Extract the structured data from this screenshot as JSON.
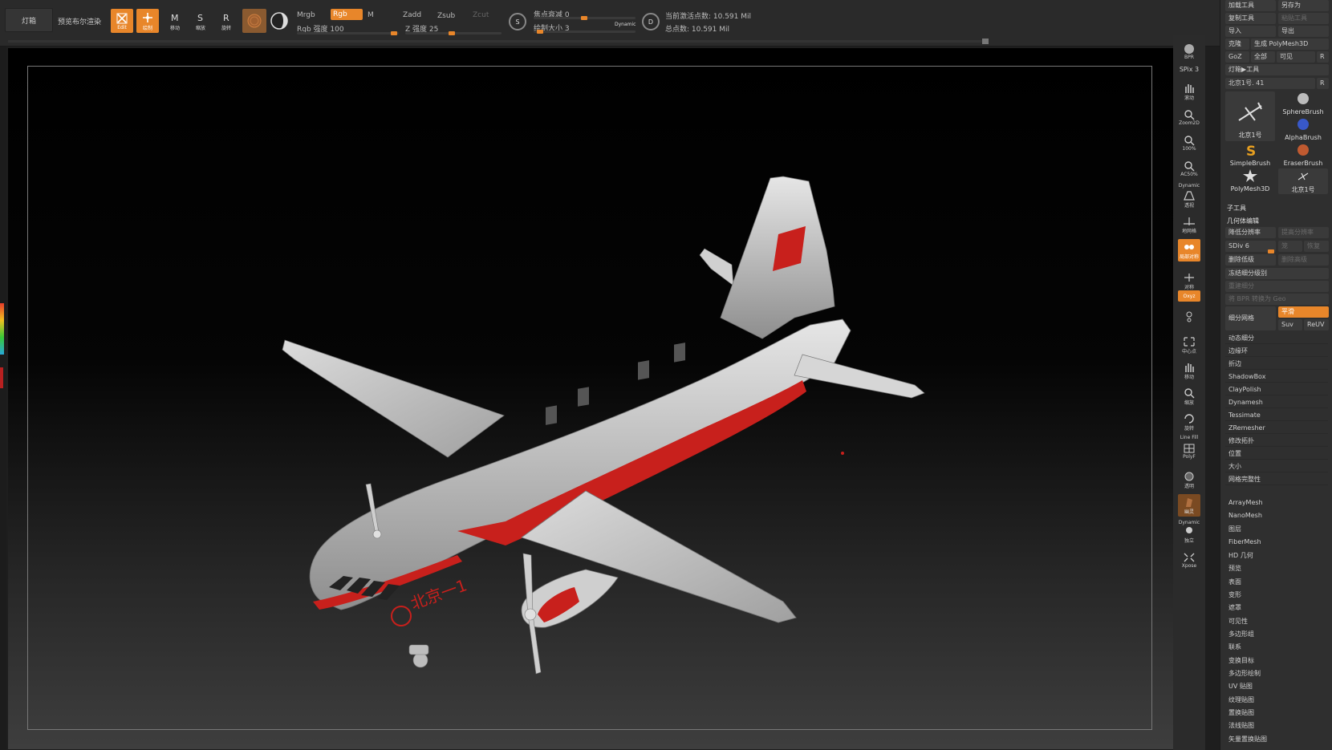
{
  "toolbar": {
    "lamp": "灯箱",
    "preview": "预览布尔渲染",
    "edit": "Edit",
    "draw": "绘制",
    "move": "移动",
    "scale": "缩放",
    "rotate": "旋转",
    "mrgb": "Mrgb",
    "rgb": "Rgb",
    "m": "M",
    "zadd": "Zadd",
    "zsub": "Zsub",
    "zcut": "Zcut",
    "rgb_intensity": "Rgb 强度 100",
    "z_intensity": "Z 强度 25",
    "focal_shift": "焦点衰减 0",
    "draw_size": "绘制大小 3",
    "dynamic": "Dynamic",
    "active_points": "当前激活点数: 10.591 Mil",
    "total_points": "总点数: 10.591 Mil"
  },
  "shelf": {
    "bpr": "BPR",
    "spix": "SPix 3",
    "scroll": "滚动",
    "zoom2d": "Zoom2D",
    "actual": "100%",
    "ac50": "AC50%",
    "dynamic": "Dynamic",
    "persp": "透视",
    "floor": "地网格",
    "localsym": "局部对称",
    "pair": "对称",
    "xyz": "Oxyz",
    "frame": "中心点",
    "move": "移动",
    "zoom": "缩放",
    "rotate": "旋转",
    "linefill": "Line Fill",
    "polyf": "PolyF",
    "transp": "透明",
    "ghost": "幽灵",
    "solo": "独立",
    "dynamic2": "Dynamic",
    "xpose": "Xpose"
  },
  "panel": {
    "load": "加载工具",
    "saveas": "另存为",
    "copy": "复制工具",
    "paste": "粘贴工具",
    "import": "导入",
    "export": "导出",
    "clone": "克隆",
    "make_poly": "生成 PolyMesh3D",
    "goz": "GoZ",
    "all": "全部",
    "visible": "可见",
    "r": "R",
    "lightbox_tools": "灯箱▶工具",
    "current_tool": "北京1号. 41",
    "thumbs": [
      "北京1号",
      "SphereBrush",
      "AlphaBrush",
      "SimpleBrush",
      "EraserBrush",
      "PolyMesh3D",
      "北京1号"
    ],
    "subtool": "子工具",
    "geometry": "几何体编辑",
    "lower_res": "降低分辨率",
    "higher_res": "提高分辨率",
    "sdiv": "SDiv 6",
    "cage": "笼",
    "rstr": "恢复",
    "del_lower": "删除低级",
    "del_higher": "删除高级",
    "freeze": "冻结细分级别",
    "reconstruct": "重建细分",
    "bpr_geo": "将 BPR 转换为 Geo",
    "divide": "细分网格",
    "smooth": "平滑",
    "suv": "Suv",
    "reuv": "ReUV",
    "geo_items": [
      "动态细分",
      "边缘环",
      "折边",
      "ShadowBox",
      "ClayPolish",
      "Dynamesh",
      "Tessimate",
      "ZRemesher",
      "修改拓扑",
      "位置",
      "大小",
      "网格完整性"
    ],
    "more_items": [
      "ArrayMesh",
      "NanoMesh",
      "图层",
      "FiberMesh",
      "HD 几何",
      "预览",
      "表面",
      "变形",
      "遮罩",
      "可见性",
      "多边形组",
      "联系",
      "变换目标",
      "多边形绘制",
      "UV 贴图",
      "纹理贴图",
      "置换贴图",
      "法线贴图",
      "矢量置换贴图"
    ]
  },
  "model": {
    "fuselage_label": "北京一1"
  },
  "colors": {
    "accent": "#e8862a",
    "livery_red": "#c8201c",
    "plane_body": "#cfcfcf"
  }
}
